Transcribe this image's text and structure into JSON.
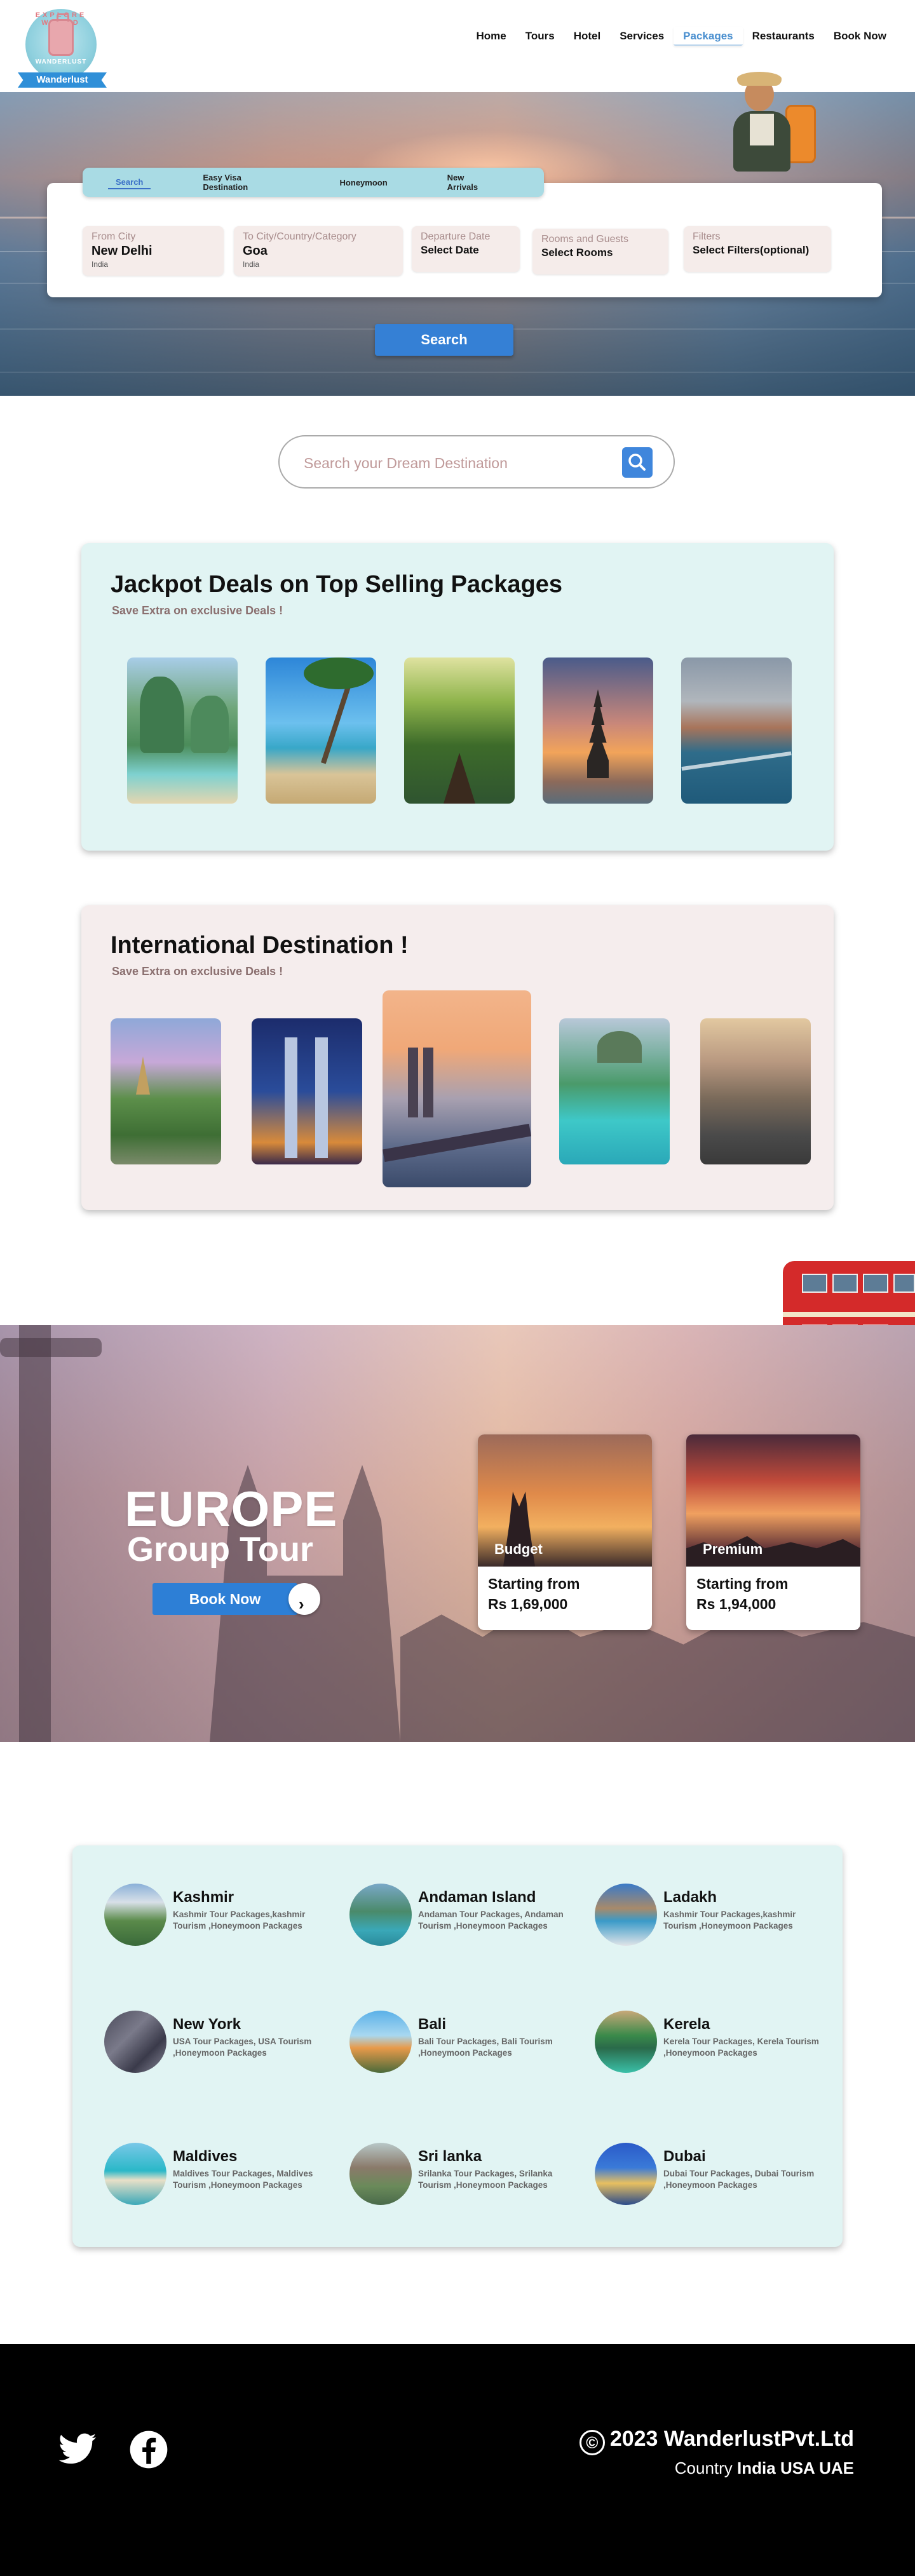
{
  "header": {
    "logo": {
      "arc_text": "EXPLORE WORLD",
      "mini_text": "WANDERLUST",
      "name": "Wanderlust"
    },
    "nav": [
      {
        "label": "Home",
        "active": false
      },
      {
        "label": "Tours",
        "active": false
      },
      {
        "label": "Hotel",
        "active": false
      },
      {
        "label": "Services",
        "active": false
      },
      {
        "label": "Packages",
        "active": true
      },
      {
        "label": "Restaurants",
        "active": false
      },
      {
        "label": "Book Now",
        "active": false
      }
    ]
  },
  "hero": {
    "tabs": [
      {
        "label": "Search",
        "active": true
      },
      {
        "label": "Easy Visa Destination",
        "active": false
      },
      {
        "label": "Honeymoon",
        "active": false
      },
      {
        "label": "New Arrivals",
        "active": false
      }
    ],
    "fields": {
      "from": {
        "label": "From City",
        "value": "New Delhi",
        "sub": "India"
      },
      "to": {
        "label": "To City/Country/Category",
        "value": "Goa",
        "sub": "India"
      },
      "date": {
        "label": "Departure Date",
        "value": "Select Date"
      },
      "rooms": {
        "label": "Rooms and Guests",
        "value": "Select Rooms"
      },
      "filters": {
        "label": "Filters",
        "value": "Select Filters(optional)"
      }
    },
    "search_button": "Search"
  },
  "destination_search": {
    "placeholder": "Search your Dream Destination"
  },
  "jackpot": {
    "title": "Jackpot Deals on Top Selling Packages",
    "subtitle": "Save Extra on exclusive Deals !",
    "images": [
      "cliff-lagoon",
      "palm-beach",
      "river-boat",
      "bali-temple",
      "coastal-cliffs"
    ]
  },
  "international": {
    "title": "International  Destination  !",
    "subtitle": "Save Extra on exclusive Deals !",
    "images": [
      "mountain-pagoda",
      "petronas-towers",
      "cologne-bridge",
      "tropical-island",
      "river-city"
    ]
  },
  "europe": {
    "title": "EUROPE",
    "subtitle": "Group Tour",
    "book_button": "Book Now",
    "next_icon": "›",
    "cards": [
      {
        "tag": "Budget",
        "from": "Starting from",
        "price": "Rs 1,69,000"
      },
      {
        "tag": "Premium",
        "from": "Starting from",
        "price": "Rs 1,94,000"
      }
    ]
  },
  "places": [
    {
      "name": "Kashmir",
      "desc": "Kashmir Tour Packages,kashmir Tourism ,Honeymoon Packages",
      "thumb": "kashmir"
    },
    {
      "name": "Andaman Island",
      "desc": "Andaman Tour Packages, Andaman Tourism ,Honeymoon Packages",
      "thumb": "andaman"
    },
    {
      "name": "Ladakh",
      "desc": "Kashmir Tour Packages,kashmir Tourism ,Honeymoon Packages",
      "thumb": "ladakh"
    },
    {
      "name": "New York",
      "desc": "USA Tour Packages, USA Tourism ,Honeymoon Packages",
      "thumb": "newyork"
    },
    {
      "name": "Bali",
      "desc": "Bali Tour Packages, Bali Tourism ,Honeymoon Packages",
      "thumb": "bali"
    },
    {
      "name": "Kerela",
      "desc": "Kerela Tour Packages, Kerela Tourism ,Honeymoon Packages",
      "thumb": "kerela"
    },
    {
      "name": "Maldives",
      "desc": "Maldives Tour Packages, Maldives Tourism ,Honeymoon Packages",
      "thumb": "maldives"
    },
    {
      "name": "Sri lanka",
      "desc": "Srilanka Tour Packages, Srilanka Tourism ,Honeymoon Packages",
      "thumb": "srilanka"
    },
    {
      "name": "Dubai",
      "desc": "Dubai Tour Packages, Dubai Tourism ,Honeymoon Packages",
      "thumb": "dubai"
    }
  ],
  "footer": {
    "copyright_symbol": "©",
    "copyright": "2023 WanderlustPvt.Ltd",
    "country_label": "Country",
    "countries": "India USA UAE",
    "social": [
      "twitter-icon",
      "facebook-icon"
    ]
  },
  "colors": {
    "accent": "#3580d5",
    "teal_panel": "#e1f4f3",
    "pink_panel": "#f5eded",
    "tab_bar": "#a9dbe4"
  }
}
